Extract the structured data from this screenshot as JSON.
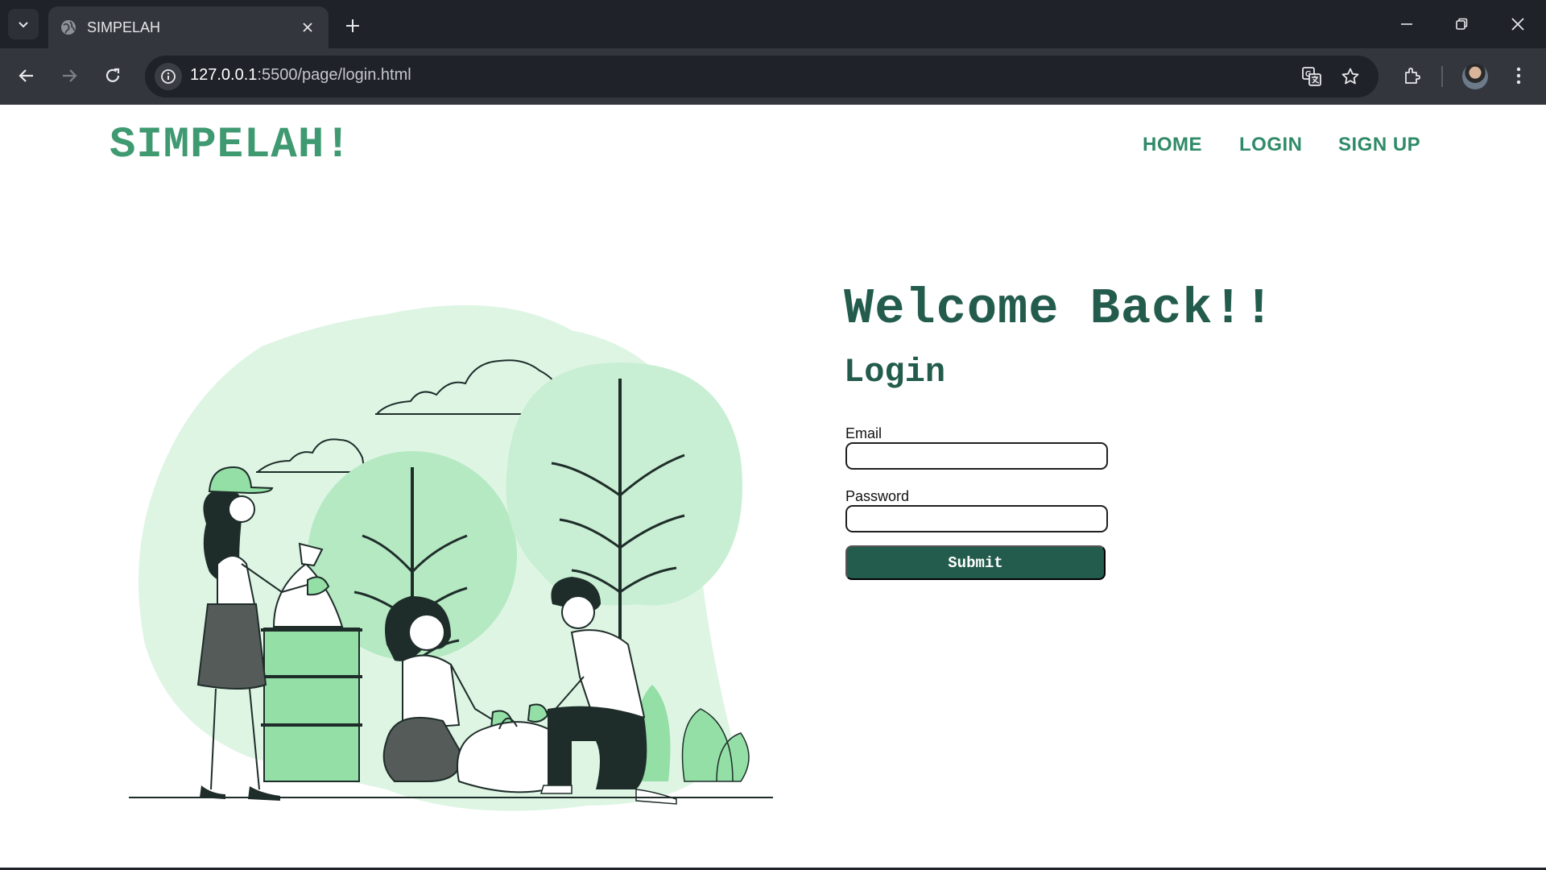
{
  "browser": {
    "tab_title": "SIMPELAH",
    "url_host": "127.0.0.1",
    "url_rest": ":5500/page/login.html"
  },
  "header": {
    "brand": "SIMPELAH!",
    "nav": [
      {
        "label": "HOME"
      },
      {
        "label": "LOGIN"
      },
      {
        "label": "SIGN UP"
      }
    ]
  },
  "login": {
    "welcome": "Welcome Back!!",
    "title": "Login",
    "email_label": "Email",
    "email_value": "",
    "password_label": "Password",
    "password_value": "",
    "submit_label": "Submit"
  },
  "colors": {
    "brand": "#3f9a72",
    "heading": "#235c4c",
    "button": "#235c4c",
    "leaf_light": "#def5e4",
    "leaf_mid": "#c8efd3",
    "leaf_dark": "#93dfa6"
  },
  "icons": [
    "tab-search-icon",
    "globe-icon",
    "close-icon",
    "plus-icon",
    "minimize-icon",
    "restore-icon",
    "window-close-icon",
    "back-arrow-icon",
    "forward-arrow-icon",
    "reload-icon",
    "info-icon",
    "translate-icon",
    "star-icon",
    "extensions-icon",
    "kebab-menu-icon"
  ]
}
